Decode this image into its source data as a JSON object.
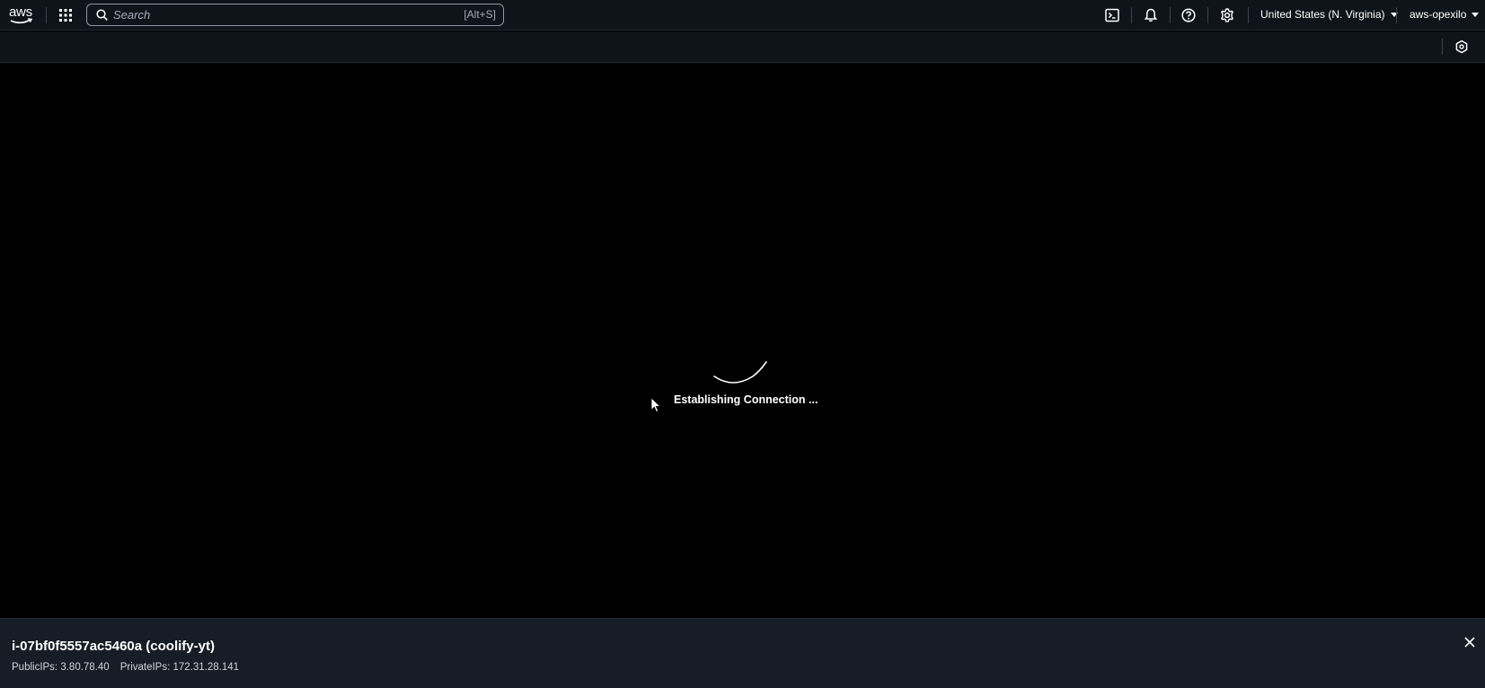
{
  "topnav": {
    "logo_text": "aws",
    "search": {
      "placeholder": "Search",
      "shortcut": "[Alt+S]"
    },
    "icons": [
      "cloudshell-icon",
      "notifications-icon",
      "help-icon",
      "settings-icon"
    ],
    "region_label": "United States (N. Virginia)",
    "account_label": "aws-opexilo"
  },
  "main": {
    "status_text": "Establishing Connection ..."
  },
  "footer": {
    "instance_title": "i-07bf0f5557ac5460a (coolify-yt)",
    "public_ips": "PublicIPs: 3.80.78.40",
    "private_ips": "PrivateIPs: 172.31.28.141"
  },
  "colors": {
    "nav_bg": "#0f141a",
    "footer_bg": "#161d26",
    "terminal_bg": "#000000"
  }
}
